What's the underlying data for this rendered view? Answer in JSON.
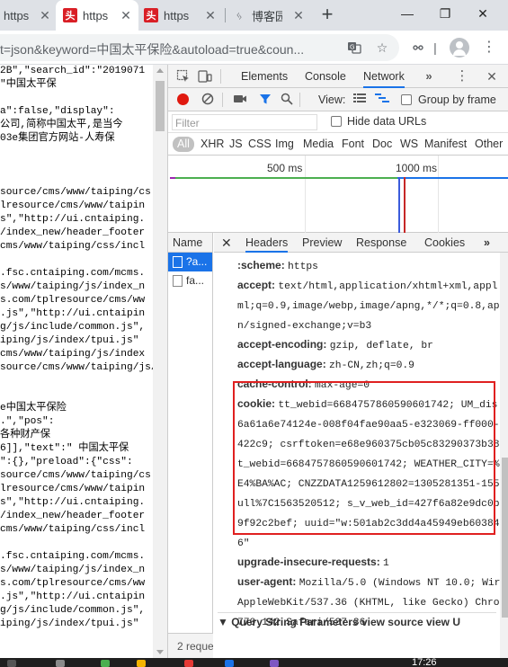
{
  "browser": {
    "tabs": [
      {
        "title": "https",
        "favicon": "site-icon-red-https"
      },
      {
        "title": "https",
        "favicon": "toutiao-icon"
      },
      {
        "title": "https",
        "favicon": "toutiao-icon"
      },
      {
        "title": "博客园",
        "favicon": "cnblogs-icon"
      }
    ],
    "url": "t=json&keyword=中国太平保险&autoload=true&coun...",
    "window_controls": [
      "minimize",
      "restore",
      "close"
    ]
  },
  "page": {
    "lines": [
      "2B\",\"search_id\":\"2019071",
      "\"中国太平保",
      "",
      "a\":false,\"display\":",
      "公司,简称中国太平,是当今",
      "03e集团官方网站-人寿保",
      "",
      "",
      "",
      "source/cms/www/taiping/cs",
      "lresource/cms/www/taipin",
      "s\",\"http://ui.cntaiping.",
      "/index_new/header_footer",
      "cms/www/taiping/css/incl",
      "",
      ".fsc.cntaiping.com/mcms.",
      "s/www/taiping/js/index_n",
      "s.com/tplresource/cms/ww",
      ".js\",\"http://ui.cntaipin",
      "g/js/include/common.js\",",
      "iping/js/index/tpui.js\"",
      "cms/www/taiping/js/index",
      "source/cms/www/taiping/js/",
      "",
      "",
      "e中国太平保险",
      ".\",\"pos\":",
      "各种财产保",
      "6]],\"text\":\" 中国太平保",
      "\":{},\"preload\":{\"css\":",
      "source/cms/www/taiping/cs",
      "lresource/cms/www/taipin",
      "s\",\"http://ui.cntaiping.",
      "/index_new/header_footer",
      "cms/www/taiping/css/incl",
      "",
      ".fsc.cntaiping.com/mcms.",
      "s/www/taiping/js/index_n",
      "s.com/tplresource/cms/ww",
      ".js\",\"http://ui.cntaipin",
      "g/js/include/common.js\",",
      "iping/js/index/tpui.js\""
    ]
  },
  "devtools": {
    "panels": [
      "Elements",
      "Console",
      "Network"
    ],
    "active_panel": "Network",
    "view_label": "View:",
    "group_by_frame": "Group by frame",
    "filter_placeholder": "Filter",
    "hide_data_urls": "Hide data URLs",
    "types": [
      "All",
      "XHR",
      "JS",
      "CSS",
      "Img",
      "Media",
      "Font",
      "Doc",
      "WS",
      "Manifest",
      "Other"
    ],
    "timeline_ticks": [
      "500 ms",
      "1000 ms"
    ],
    "name_column": "Name",
    "requests": [
      "?a...",
      "fa..."
    ],
    "requests_status": "2 reque",
    "detail_tabs": [
      "Headers",
      "Preview",
      "Response",
      "Cookies"
    ],
    "headers": [
      {
        "name": ":scheme:",
        "lines": [
          "https"
        ]
      },
      {
        "name": "accept:",
        "lines": [
          "text/html,application/xhtml+xml,appl",
          "ml;q=0.9,image/webp,image/apng,*/*;q=0.8,ap",
          "n/signed-exchange;v=b3"
        ]
      },
      {
        "name": "accept-encoding:",
        "lines": [
          "gzip, deflate, br"
        ]
      },
      {
        "name": "accept-language:",
        "lines": [
          "zh-CN,zh;q=0.9"
        ]
      },
      {
        "name": "cache-control:",
        "lines": [
          "max-age=0"
        ]
      },
      {
        "name": "cookie:",
        "lines": [
          "tt_webid=6684757860590601742; UM_dis",
          "6a61a6e74124e-008f04fae90aa5-e323069-ff000-",
          "422c9; csrftoken=e68e960375cb05c83290373b38",
          "t_webid=6684757860590601742; WEATHER_CITY=%",
          "E4%BA%AC; CNZZDATA1259612802=1305281351-155",
          "ull%7C1563520512; s_v_web_id=427f6a82e9dc0b",
          "9f92c2bef; uuid=\"w:501ab2c3dd4a45949eb60384",
          "6\""
        ]
      },
      {
        "name": "upgrade-insecure-requests:",
        "lines": [
          "1"
        ]
      },
      {
        "name": "user-agent:",
        "lines": [
          "Mozilla/5.0 (Windows NT 10.0; Wir",
          "AppleWebKit/537.36 (KHTML, like Gecko) Chror",
          "770.142 Safari/537.36"
        ]
      }
    ],
    "query_section": "▼ Query String Parameters     view source    view U"
  },
  "taskbar": {
    "time": "17:26"
  },
  "colors": {
    "accent": "#1a73e8",
    "record": "#e0190f",
    "highlight": "#e02020"
  }
}
